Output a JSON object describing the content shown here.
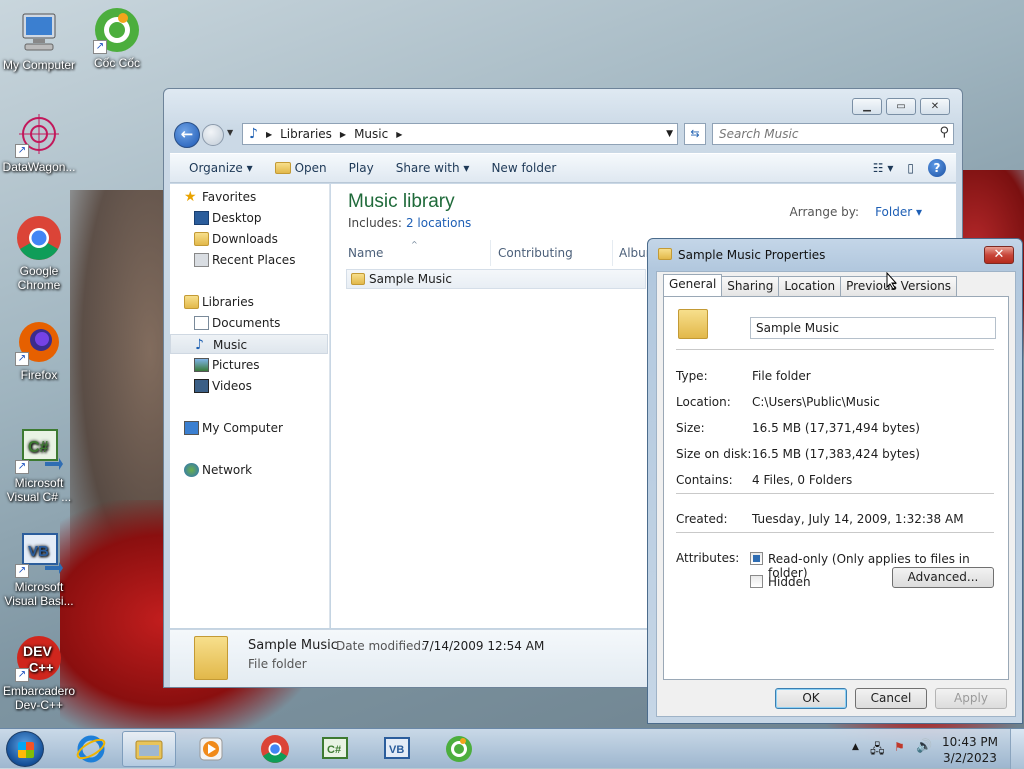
{
  "desktop": {
    "icons": [
      {
        "label": "My Computer"
      },
      {
        "label": "Cốc Cốc"
      },
      {
        "label": "DataWagon..."
      },
      {
        "label": "Google Chrome"
      },
      {
        "label": "Firefox"
      },
      {
        "label": "Microsoft Visual C# ..."
      },
      {
        "label": "Microsoft Visual Basi..."
      },
      {
        "label": "Embarcadero Dev-C++"
      }
    ]
  },
  "explorer": {
    "breadcrumb": [
      "Libraries",
      "Music"
    ],
    "search_placeholder": "Search Music",
    "toolbar": {
      "organize": "Organize",
      "open": "Open",
      "play": "Play",
      "share_with": "Share with",
      "new_folder": "New folder"
    },
    "nav": {
      "favorites": "Favorites",
      "desktop": "Desktop",
      "downloads": "Downloads",
      "recent_places": "Recent Places",
      "libraries": "Libraries",
      "documents": "Documents",
      "music": "Music",
      "pictures": "Pictures",
      "videos": "Videos",
      "my_computer": "My Computer",
      "network": "Network"
    },
    "library": {
      "title": "Music library",
      "includes_label": "Includes:",
      "includes_link": "2 locations",
      "arrange_label": "Arrange by:",
      "arrange_value": "Folder"
    },
    "columns": [
      "Name",
      "Contributing artists",
      "Album"
    ],
    "files": [
      {
        "name": "Sample Music"
      }
    ],
    "details": {
      "name": "Sample Music",
      "modified_label": "Date modified:",
      "modified_value": "7/14/2009 12:54 AM",
      "type": "File folder"
    }
  },
  "properties": {
    "title": "Sample Music Properties",
    "tabs": [
      "General",
      "Sharing",
      "Location",
      "Previous Versions"
    ],
    "name_value": "Sample Music",
    "rows": {
      "type_label": "Type:",
      "type_value": "File folder",
      "location_label": "Location:",
      "location_value": "C:\\Users\\Public\\Music",
      "size_label": "Size:",
      "size_value": "16.5 MB (17,371,494 bytes)",
      "size_on_disk_label": "Size on disk:",
      "size_on_disk_value": "16.5 MB (17,383,424 bytes)",
      "contains_label": "Contains:",
      "contains_value": "4 Files, 0 Folders",
      "created_label": "Created:",
      "created_value": "Tuesday, July 14, 2009, 1:32:38 AM",
      "attributes_label": "Attributes:"
    },
    "readonly_label": "Read-only (Only applies to files in folder)",
    "hidden_label": "Hidden",
    "advanced_button": "Advanced...",
    "ok_button": "OK",
    "cancel_button": "Cancel",
    "apply_button": "Apply"
  },
  "taskbar": {
    "time": "10:43 PM",
    "date": "3/2/2023"
  },
  "colors": {
    "accent": "#1e5fb5",
    "library_title": "#1f6a3a"
  }
}
